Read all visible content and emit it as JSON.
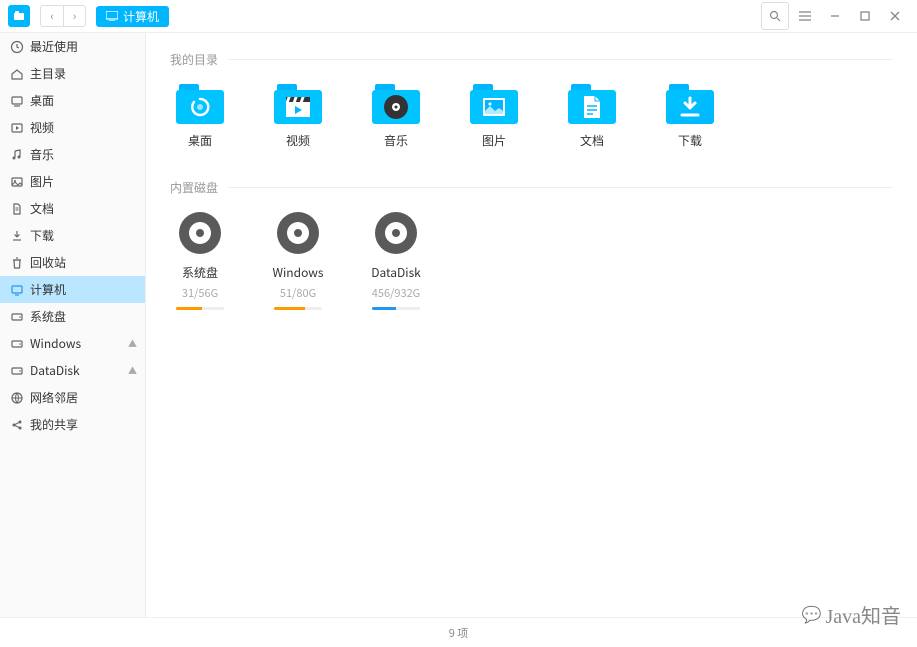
{
  "titlebar": {
    "location": "计算机"
  },
  "sidebar": {
    "items": [
      {
        "id": "recent",
        "icon": "clock",
        "label": "最近使用"
      },
      {
        "id": "home",
        "icon": "home",
        "label": "主目录"
      },
      {
        "id": "desktop",
        "icon": "desktop",
        "label": "桌面"
      },
      {
        "id": "videos",
        "icon": "video",
        "label": "视频"
      },
      {
        "id": "music",
        "icon": "music",
        "label": "音乐"
      },
      {
        "id": "pictures",
        "icon": "image",
        "label": "图片"
      },
      {
        "id": "documents",
        "icon": "document",
        "label": "文档"
      },
      {
        "id": "downloads",
        "icon": "download",
        "label": "下载"
      },
      {
        "id": "trash",
        "icon": "trash",
        "label": "回收站"
      },
      {
        "id": "computer",
        "icon": "computer",
        "label": "计算机",
        "active": true
      },
      {
        "id": "systemdisk",
        "icon": "disk",
        "label": "系统盘"
      },
      {
        "id": "windows",
        "icon": "disk",
        "label": "Windows",
        "eject": true
      },
      {
        "id": "datadisk",
        "icon": "disk",
        "label": "DataDisk",
        "eject": true
      },
      {
        "id": "network",
        "icon": "network",
        "label": "网络邻居"
      },
      {
        "id": "shares",
        "icon": "share",
        "label": "我的共享"
      }
    ]
  },
  "main": {
    "sections": [
      {
        "id": "mydirs",
        "title": "我的目录",
        "type": "folders",
        "items": [
          {
            "id": "desktop",
            "label": "桌面",
            "icon": "spiral"
          },
          {
            "id": "videos",
            "label": "视频",
            "icon": "clapper"
          },
          {
            "id": "music",
            "label": "音乐",
            "icon": "disc"
          },
          {
            "id": "pictures",
            "label": "图片",
            "icon": "picture"
          },
          {
            "id": "documents",
            "label": "文档",
            "icon": "doc"
          },
          {
            "id": "downloads",
            "label": "下载",
            "icon": "download"
          }
        ]
      },
      {
        "id": "internal",
        "title": "内置磁盘",
        "type": "disks",
        "items": [
          {
            "id": "systemdisk",
            "label": "系统盘",
            "sub": "31/56G",
            "fill": 55,
            "color": "#ff9900"
          },
          {
            "id": "windows",
            "label": "Windows",
            "sub": "51/80G",
            "fill": 64,
            "color": "#ff9900"
          },
          {
            "id": "datadisk",
            "label": "DataDisk",
            "sub": "456/932G",
            "fill": 49,
            "color": "#2196f3"
          }
        ]
      }
    ]
  },
  "statusbar": {
    "count": "9 项"
  },
  "watermark": "Java知音"
}
